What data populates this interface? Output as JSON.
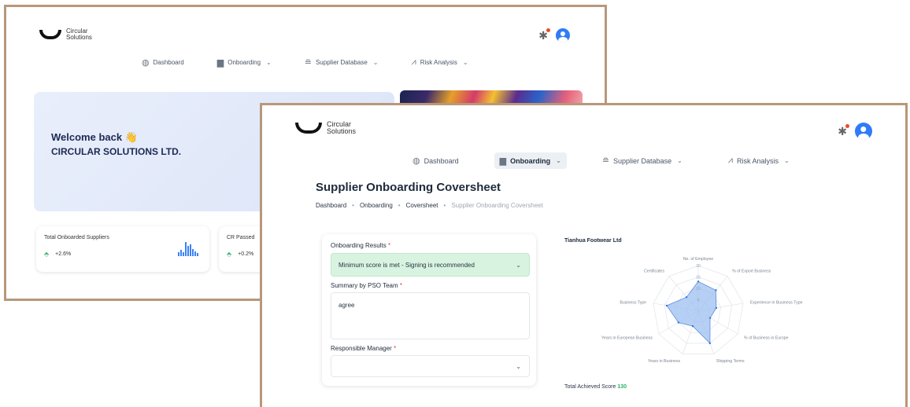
{
  "brand": {
    "line1": "Circular",
    "line2": "Solutions"
  },
  "icons": {
    "settings": "gear-icon",
    "user": "user-avatar-icon",
    "dashboard": "dashboard-icon",
    "onboarding": "inbox-icon",
    "supplier": "database-icon",
    "risk": "chart-icon",
    "chevron": "chevron-down-icon",
    "trend": "trend-up-icon"
  },
  "nav": [
    {
      "label": "Dashboard"
    },
    {
      "label": "Onboarding"
    },
    {
      "label": "Supplier Database"
    },
    {
      "label": "Risk Analysis"
    }
  ],
  "back_window": {
    "welcome_title": "Welcome back",
    "welcome_company": "CIRCULAR SOLUTIONS LTD.",
    "stats": [
      {
        "label": "Total Onboarded Suppliers",
        "change": "+2.6%"
      },
      {
        "label": "CR Passed",
        "change": "+0.2%"
      }
    ],
    "mini_bars": [
      0.25,
      0.45,
      0.3,
      1.0,
      0.7,
      0.85,
      0.5,
      0.35,
      0.2
    ]
  },
  "front_window": {
    "title": "Supplier Onboarding Coversheet",
    "breadcrumb": [
      "Dashboard",
      "Onboarding",
      "Coversheet",
      "Supplier Onboarding Coversheet"
    ],
    "form": {
      "results_label": "Onboarding Results",
      "results_value": "Minimum score is met - Signing is recommended",
      "summary_label": "Summary by PSO Team",
      "summary_value": "agree",
      "manager_label": "Responsible Manager",
      "manager_value": "",
      "required_mark": "*"
    },
    "company": "Tianhua Footwear Ltd",
    "total_score_label": "Total Achieved Score",
    "total_score_value": "130"
  },
  "colors": {
    "accent": "#2f7cf6",
    "success": "#2db36a",
    "frame": "#b8977a",
    "result_bg": "#d8f3e0",
    "radar_fill": "#9dbff0"
  },
  "chart_data": {
    "type": "radar",
    "title": "Tianhua Footwear Ltd",
    "axes": [
      "No. of Employee",
      "% of Export Business",
      "Experience in Business Type",
      "% of Business in Europe",
      "Shipping Terms",
      "Years in Business",
      "Years in European Business",
      "Business Type",
      "Certificates"
    ],
    "ticks": [
      5,
      10,
      15,
      20
    ],
    "range": [
      0,
      20
    ],
    "values": [
      13,
      12,
      8,
      6,
      15,
      7,
      10,
      14,
      8
    ]
  }
}
